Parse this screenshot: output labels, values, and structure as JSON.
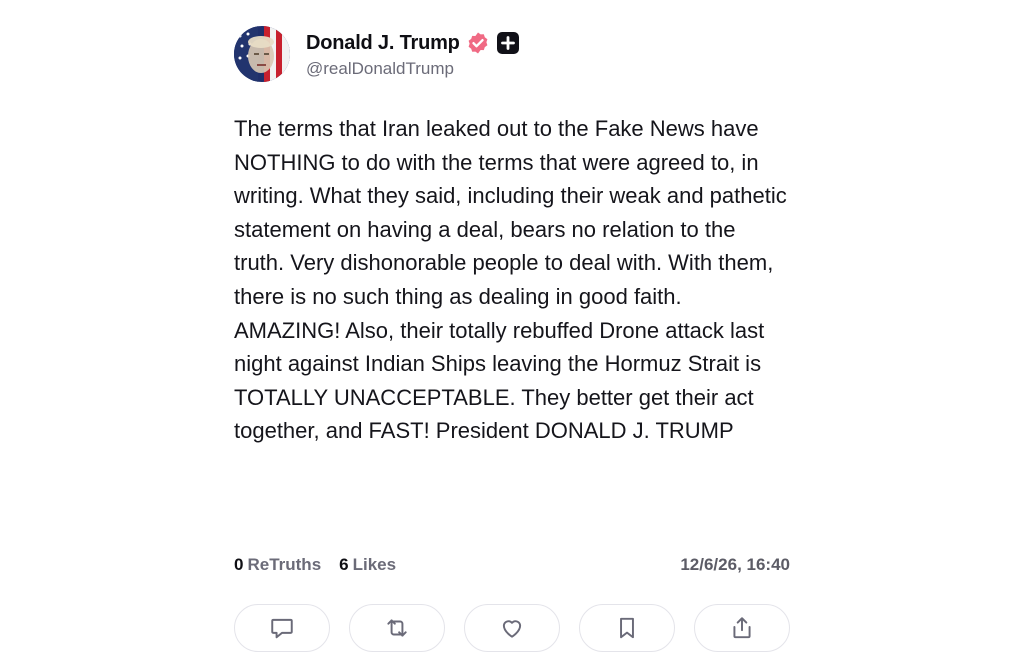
{
  "author": {
    "display_name": "Donald J. Trump",
    "handle": "@realDonaldTrump",
    "verified_badge": "verified-check-icon",
    "verified_color": "#f06a84",
    "plus_badge": "plus-square-icon"
  },
  "post": {
    "text": "The terms that Iran leaked out to the Fake News have NOTHING to do with the terms that were agreed to, in writing. What they said, including their weak and pathetic statement on having a deal, bears no relation to the truth. Very dishonorable people to deal with. With them, there is no such thing as dealing in good faith. AMAZING! Also, their totally rebuffed Drone attack last night against Indian Ships leaving the Hormuz Strait is TOTALLY UNACCEPTABLE. They better get their act together, and FAST! President DONALD J. TRUMP"
  },
  "stats": {
    "retruths_count": "0",
    "retruths_label": "ReTruths",
    "likes_count": "6",
    "likes_label": "Likes",
    "timestamp": "12/6/26, 16:40"
  },
  "actions": [
    {
      "name": "reply",
      "icon": "comment-icon"
    },
    {
      "name": "retruth",
      "icon": "repost-icon"
    },
    {
      "name": "like",
      "icon": "heart-icon"
    },
    {
      "name": "bookmark",
      "icon": "bookmark-icon"
    },
    {
      "name": "share",
      "icon": "share-icon"
    }
  ]
}
